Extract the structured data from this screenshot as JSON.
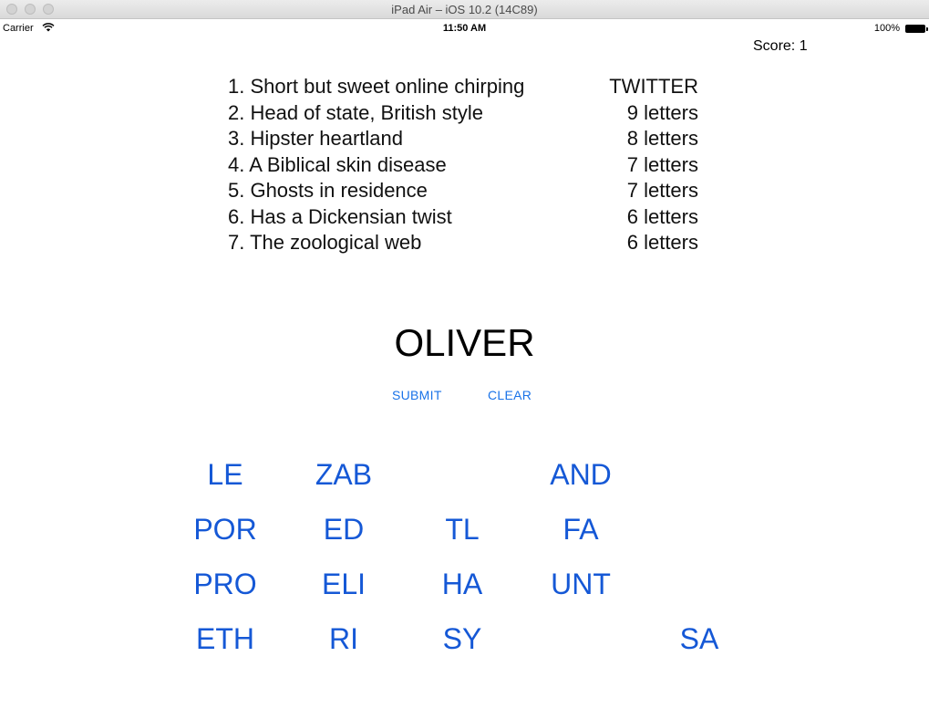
{
  "window": {
    "title": "iPad Air – iOS 10.2 (14C89)"
  },
  "status_bar": {
    "carrier": "Carrier",
    "time": "11:50 AM",
    "battery": "100%"
  },
  "score": "Score: 1",
  "clues": [
    {
      "text": "1. Short but sweet online chirping",
      "answer": "TWITTER"
    },
    {
      "text": "2. Head of state, British style",
      "answer": "9 letters"
    },
    {
      "text": "3. Hipster heartland",
      "answer": "8 letters"
    },
    {
      "text": "4. A Biblical skin disease",
      "answer": "7 letters"
    },
    {
      "text": "5. Ghosts in residence",
      "answer": "7 letters"
    },
    {
      "text": "6. Has a Dickensian twist",
      "answer": "6 letters"
    },
    {
      "text": "7. The zoological web",
      "answer": "6 letters"
    }
  ],
  "current_word": "OLIVER",
  "buttons": {
    "submit": "SUBMIT",
    "clear": "CLEAR"
  },
  "tiles": {
    "r1c1": "LE",
    "r1c2": "ZAB",
    "r1c4": "AND",
    "r2c1": "POR",
    "r2c2": "ED",
    "r2c3": "TL",
    "r2c4": "FA",
    "r3c1": "PRO",
    "r3c2": "ELI",
    "r3c3": "HA",
    "r3c4": "UNT",
    "r4c1": "ETH",
    "r4c2": "RI",
    "r4c3": "SY",
    "r4c5": "SA"
  },
  "colors": {
    "accent": "#1558d6",
    "button": "#1a73e8"
  }
}
